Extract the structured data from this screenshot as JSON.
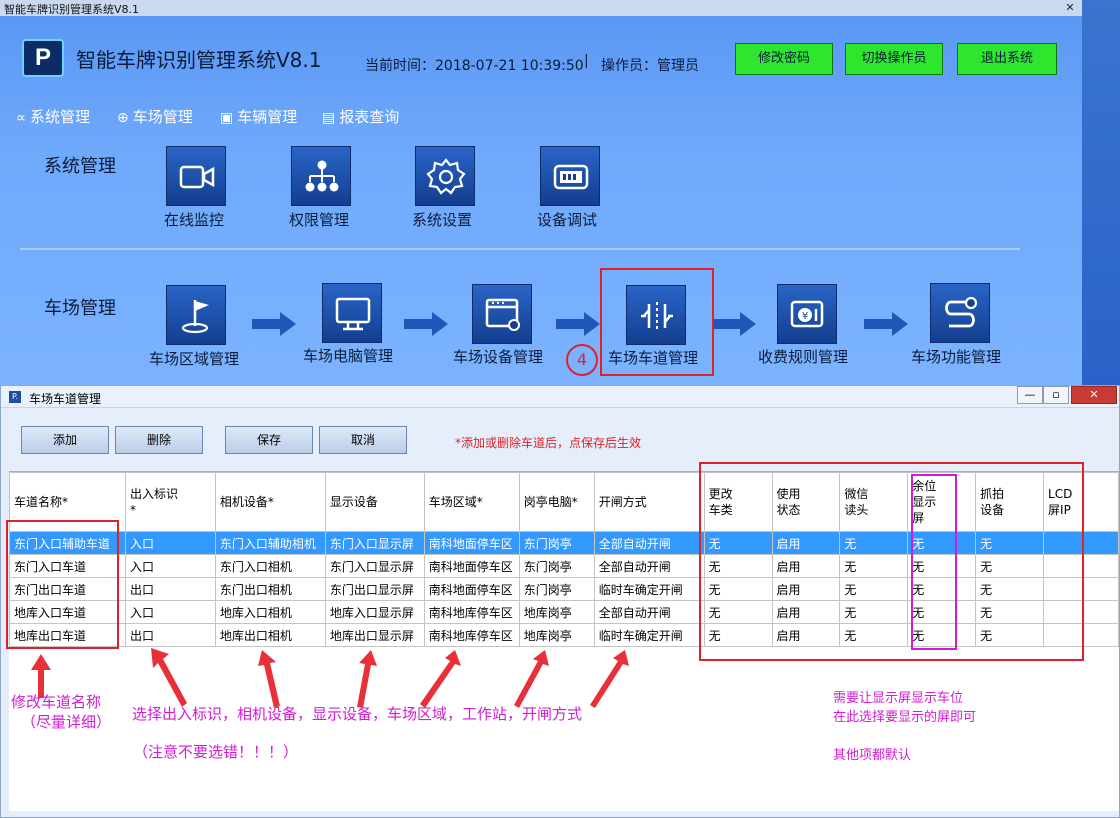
{
  "app": {
    "window_title": "智能车牌识别管理系统V8.1",
    "close_glyph": "✕",
    "logo_letter": "P",
    "title": "智能车牌识别管理系统V8.1",
    "datetime": "当前时间：2018-07-21 10:39:50",
    "separator": "|",
    "operator": "操作员：管理员",
    "buttons": {
      "change_password": "修改密码",
      "switch_operator": "切换操作员",
      "exit": "退出系统"
    },
    "accent_green": "#2fe62f"
  },
  "menu": [
    {
      "icon": "share-icon",
      "glyph": "∝",
      "label": "系统管理"
    },
    {
      "icon": "parking-search-icon",
      "glyph": "⊕",
      "label": "车场管理"
    },
    {
      "icon": "car-icon",
      "glyph": "▣",
      "label": "车辆管理"
    },
    {
      "icon": "report-icon",
      "glyph": "▤",
      "label": "报表查询"
    }
  ],
  "system_section": {
    "title": "系统管理",
    "items": [
      "在线监控",
      "权限管理",
      "系统设置",
      "设备调试"
    ]
  },
  "parking_section": {
    "title": "车场管理",
    "items": [
      "车场区域管理",
      "车场电脑管理",
      "车场设备管理",
      "车场车道管理",
      "收费规则管理",
      "车场功能管理"
    ],
    "step_number": "4"
  },
  "dialog": {
    "logo_letter": "P.",
    "title": "车场车道管理",
    "window_buttons": {
      "minimize": "—",
      "restore": "▫",
      "close": "✕"
    },
    "buttons": {
      "add": "添加",
      "delete": "删除",
      "save": "保存",
      "cancel": "取消"
    },
    "hint": "*添加或删除车道后，点保存后生效",
    "columns": [
      [
        "车道名称*"
      ],
      [
        "出入标识",
        "*"
      ],
      [
        "相机设备*"
      ],
      [
        "显示设备"
      ],
      [
        "车场区域*"
      ],
      [
        "岗亭电脑*"
      ],
      [
        "开闸方式"
      ],
      [
        "更改",
        "车类"
      ],
      [
        "使用",
        "状态"
      ],
      [
        "微信",
        "读头"
      ],
      [
        "余位",
        "显示",
        "屏"
      ],
      [
        "抓拍",
        "设备"
      ],
      [
        "LCD",
        "屏IP"
      ]
    ],
    "rows": [
      [
        "东门入口辅助车道",
        "入口",
        "东门入口辅助相机",
        "东门入口显示屏",
        "南科地面停车区",
        "东门岗亭",
        "全部自动开闸",
        "无",
        "启用",
        "无",
        "无",
        "无",
        ""
      ],
      [
        "东门入口车道",
        "入口",
        "东门入口相机",
        "东门入口显示屏",
        "南科地面停车区",
        "东门岗亭",
        "全部自动开闸",
        "无",
        "启用",
        "无",
        "无",
        "无",
        ""
      ],
      [
        "东门出口车道",
        "出口",
        "东门出口相机",
        "东门出口显示屏",
        "南科地面停车区",
        "东门岗亭",
        "临时车确定开闸",
        "无",
        "启用",
        "无",
        "无",
        "无",
        ""
      ],
      [
        "地库入口车道",
        "入口",
        "地库入口相机",
        "地库入口显示屏",
        "南科地库停车区",
        "地库岗亭",
        "全部自动开闸",
        "无",
        "启用",
        "无",
        "无",
        "无",
        ""
      ],
      [
        "地库出口车道",
        "出口",
        "地库出口相机",
        "地库出口显示屏",
        "南科地库停车区",
        "地库岗亭",
        "临时车确定开闸",
        "无",
        "启用",
        "无",
        "无",
        "无",
        ""
      ]
    ],
    "selected_row": 0
  },
  "annotations": {
    "rename": [
      "修改车道名称",
      "（尽量详细）"
    ],
    "select": "选择出入标识，相机设备，显示设备，车场区域，工作站，开闸方式",
    "caution": "（注意不要选错！！！）",
    "display": [
      "需要让显示屏显示车位",
      "在此选择要显示的屏即可"
    ],
    "default": "其他项都默认",
    "red": "#e0212a",
    "magenta": "#d21cd2"
  }
}
